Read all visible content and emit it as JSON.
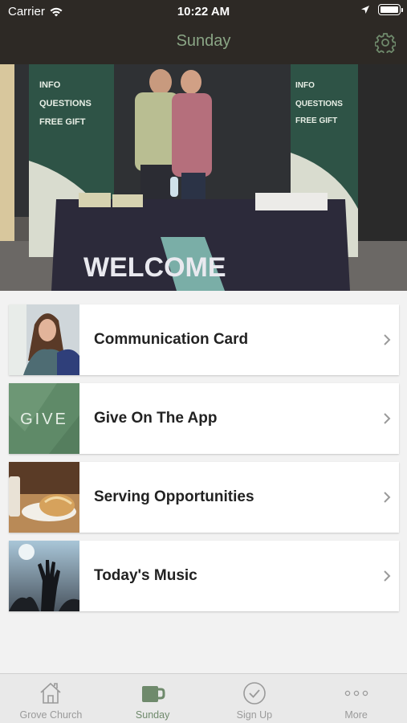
{
  "status_bar": {
    "carrier": "Carrier",
    "time": "10:22 AM"
  },
  "nav": {
    "title": "Sunday"
  },
  "hero": {
    "banner_left": [
      "INFO",
      "QUESTIONS",
      "FREE GIFT"
    ],
    "banner_right": [
      "INFO",
      "QUESTIONS",
      "FREE GIFT"
    ],
    "table_text": "WELCOME"
  },
  "list": {
    "items": [
      {
        "label": "Communication Card",
        "thumb": "woman-photo"
      },
      {
        "label": "Give On The App",
        "thumb_text": "GIVE"
      },
      {
        "label": "Serving Opportunities",
        "thumb": "bread-photo"
      },
      {
        "label": "Today's Music",
        "thumb": "worship-photo"
      }
    ]
  },
  "tabbar": {
    "tabs": [
      {
        "label": "Grove Church",
        "icon": "home-icon",
        "active": false
      },
      {
        "label": "Sunday",
        "icon": "mug-icon",
        "active": true
      },
      {
        "label": "Sign Up",
        "icon": "check-circle-icon",
        "active": false
      },
      {
        "label": "More",
        "icon": "more-dots-icon",
        "active": false
      }
    ]
  },
  "colors": {
    "nav_bg": "#2d2925",
    "accent": "#6f8a6c",
    "title": "#8aa585"
  }
}
